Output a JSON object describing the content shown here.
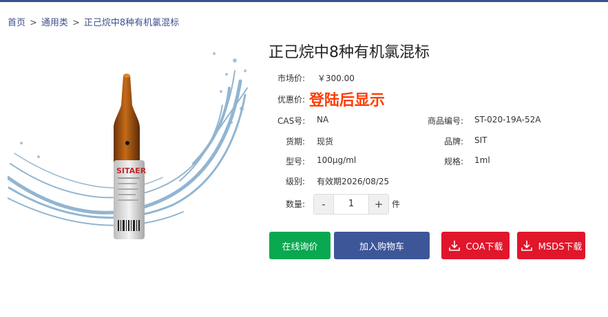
{
  "breadcrumb": {
    "home": "首页",
    "category": "通用类",
    "current": "正己烷中8种有机氯混标",
    "separator": ">"
  },
  "product": {
    "title": "正己烷中8种有机氯混标",
    "vial_label_text": "SITAER",
    "market_price_label": "市场价:",
    "market_price_value": "￥300.00",
    "discount_label": "优惠价:",
    "discount_value": "登陆后显示",
    "cas_label": "CAS号:",
    "cas_value": "NA",
    "code_label": "商品编号:",
    "code_value": "ST-020-19A-52A",
    "period_label": "货期:",
    "period_value": "现货",
    "brand_label": "品牌:",
    "brand_value": "SIT",
    "model_label": "型号:",
    "model_value": "100μg/ml",
    "spec_label": "规格:",
    "spec_value": "1ml",
    "level_label": "级别:",
    "level_value": "有效期2026/08/25"
  },
  "quantity": {
    "label": "数量:",
    "minus": "-",
    "value": "1",
    "plus": "+",
    "unit": "件"
  },
  "buttons": {
    "inquiry": "在线询价",
    "add_cart": "加入购物车",
    "coa": "COA下载",
    "msds": "MSDS下载"
  },
  "colors": {
    "accent": "#3c4f91",
    "green": "#0aa850",
    "red": "#e0162b",
    "price_red": "#ff3b00"
  }
}
